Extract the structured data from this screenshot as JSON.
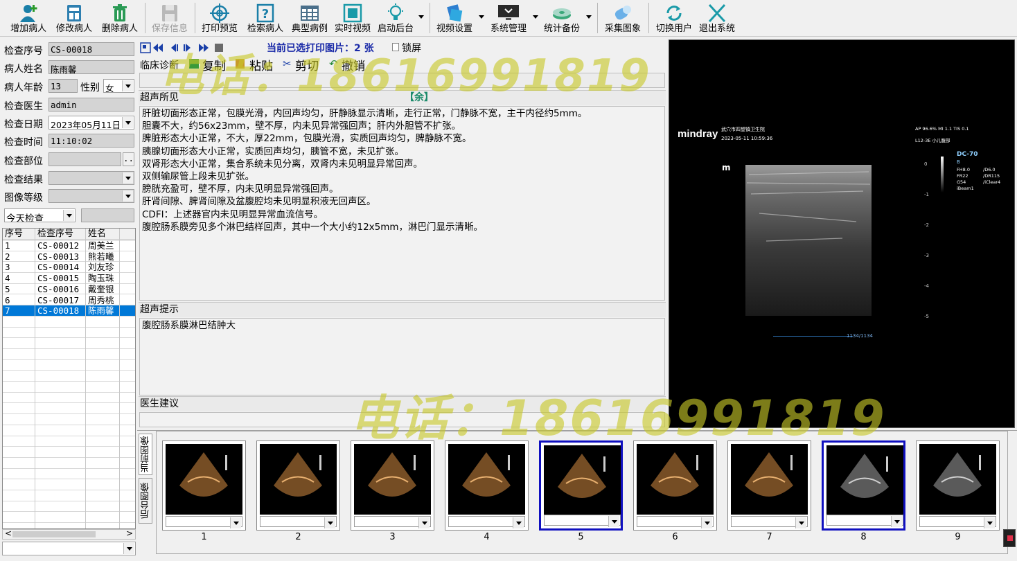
{
  "toolbar": {
    "buttons": [
      {
        "label": "增加病人",
        "icon": "add-patient-icon"
      },
      {
        "label": "修改病人",
        "icon": "edit-patient-icon"
      },
      {
        "label": "删除病人",
        "icon": "trash-icon"
      },
      {
        "label": "保存信息",
        "icon": "save-icon",
        "disabled": true
      },
      {
        "label": "打印预览",
        "icon": "print-preview-icon"
      },
      {
        "label": "检索病人",
        "icon": "search-help-icon"
      },
      {
        "label": "典型病例",
        "icon": "grid-icon"
      },
      {
        "label": "实时视频",
        "icon": "video-frame-icon"
      },
      {
        "label": "启动后台",
        "icon": "bulb-icon"
      },
      {
        "label": "视频设置",
        "icon": "video-settings-icon"
      },
      {
        "label": "系统管理",
        "icon": "monitor-icon"
      },
      {
        "label": "统计备份",
        "icon": "disk-icon"
      },
      {
        "label": "采集图象",
        "icon": "capture-icon"
      },
      {
        "label": "切换用户",
        "icon": "switch-user-icon"
      },
      {
        "label": "退出系统",
        "icon": "close-x-icon"
      }
    ]
  },
  "form": {
    "exam_no_label": "检查序号",
    "exam_no": "CS-00018",
    "name_label": "病人姓名",
    "name": "陈雨馨",
    "age_label": "病人年龄",
    "age": "13",
    "sex_label": "性别",
    "sex": "女",
    "doctor_label": "检查医生",
    "doctor": "admin",
    "date_label": "检查日期",
    "date": "2023年05月11日",
    "time_label": "检查时间",
    "time": "11:10:02",
    "part_label": "检查部位",
    "part": "",
    "result_label": "检查结果",
    "result": "",
    "grade_label": "图像等级",
    "grade": "",
    "filter": "今天检查"
  },
  "patients": {
    "headers": [
      "序号",
      "检查序号",
      "姓名"
    ],
    "rows": [
      [
        "1",
        "CS-00012",
        "周美兰"
      ],
      [
        "2",
        "CS-00013",
        "熊若曦"
      ],
      [
        "3",
        "CS-00014",
        "刘友珍"
      ],
      [
        "4",
        "CS-00015",
        "陶玉珠"
      ],
      [
        "5",
        "CS-00016",
        "戴奎银"
      ],
      [
        "6",
        "CS-00017",
        "周秀桃"
      ],
      [
        "7",
        "CS-00018",
        "陈雨馨"
      ]
    ],
    "selected_index": 6
  },
  "report": {
    "print_status": "当前已选打印图片：2 张",
    "lock_label": "锁屏",
    "clinical_label": "临床诊断",
    "copy": "复制",
    "paste": "粘贴",
    "cut": "剪切",
    "undo": "撤销",
    "findings_label": "超声所见",
    "yu_tag": "【余】",
    "findings": "肝脏切面形态正常，包膜光滑，内回声均匀，肝静脉显示清晰，走行正常，门静脉不宽，主干内径约5mm。\n胆囊不大，约56x23mm，壁不厚，内未见异常强回声；肝内外胆管不扩张。\n脾脏形态大小正常，不大，厚22mm，包膜光滑，实质回声均匀，脾静脉不宽。\n胰腺切面形态大小正常，实质回声均匀，胰管不宽，未见扩张。\n双肾形态大小正常，集合系统未见分离，双肾内未见明显异常回声。\n双侧输尿管上段未见扩张。\n膀胱充盈可，壁不厚，内未见明显异常强回声。\n肝肾间隙、脾肾间隙及盆腹腔均未见明显积液无回声区。\nCDFI：上述器官内未见明显异常血流信号。\n腹腔肠系膜旁见多个淋巴结样回声，其中一个大小约12x5mm，淋巴门显示清晰。",
    "hint_label": "超声提示",
    "hint": "腹腔肠系膜淋巴结肿大",
    "advice_label": "医生建议"
  },
  "viewer": {
    "brand": "mindray",
    "hospital": "武穴市四望镇卫生院",
    "datetime": "2023-05-11 10:59:36",
    "ap": "AP 96.6%  MI 1.1  TIS 0.1",
    "probe": "L12-3E     小儿腹部",
    "model": "DC-70",
    "mode": "B",
    "params_left": [
      "FH8.0",
      "FR22",
      "G54",
      "iBeam1"
    ],
    "params_right": [
      "/D6.0",
      "/DR115",
      "/iClear4"
    ],
    "marker": "m",
    "depth_ticks": [
      "0",
      "-1",
      "-2",
      "-3",
      "-4",
      "-5"
    ],
    "frame": "1134/1134"
  },
  "thumbs": {
    "tabs": [
      "当前图像",
      "后台图像"
    ],
    "items": [
      "1",
      "2",
      "3",
      "4",
      "5",
      "6",
      "7",
      "8",
      "9"
    ],
    "selected": [
      "5",
      "8"
    ]
  },
  "watermark": "电话：18616991819"
}
